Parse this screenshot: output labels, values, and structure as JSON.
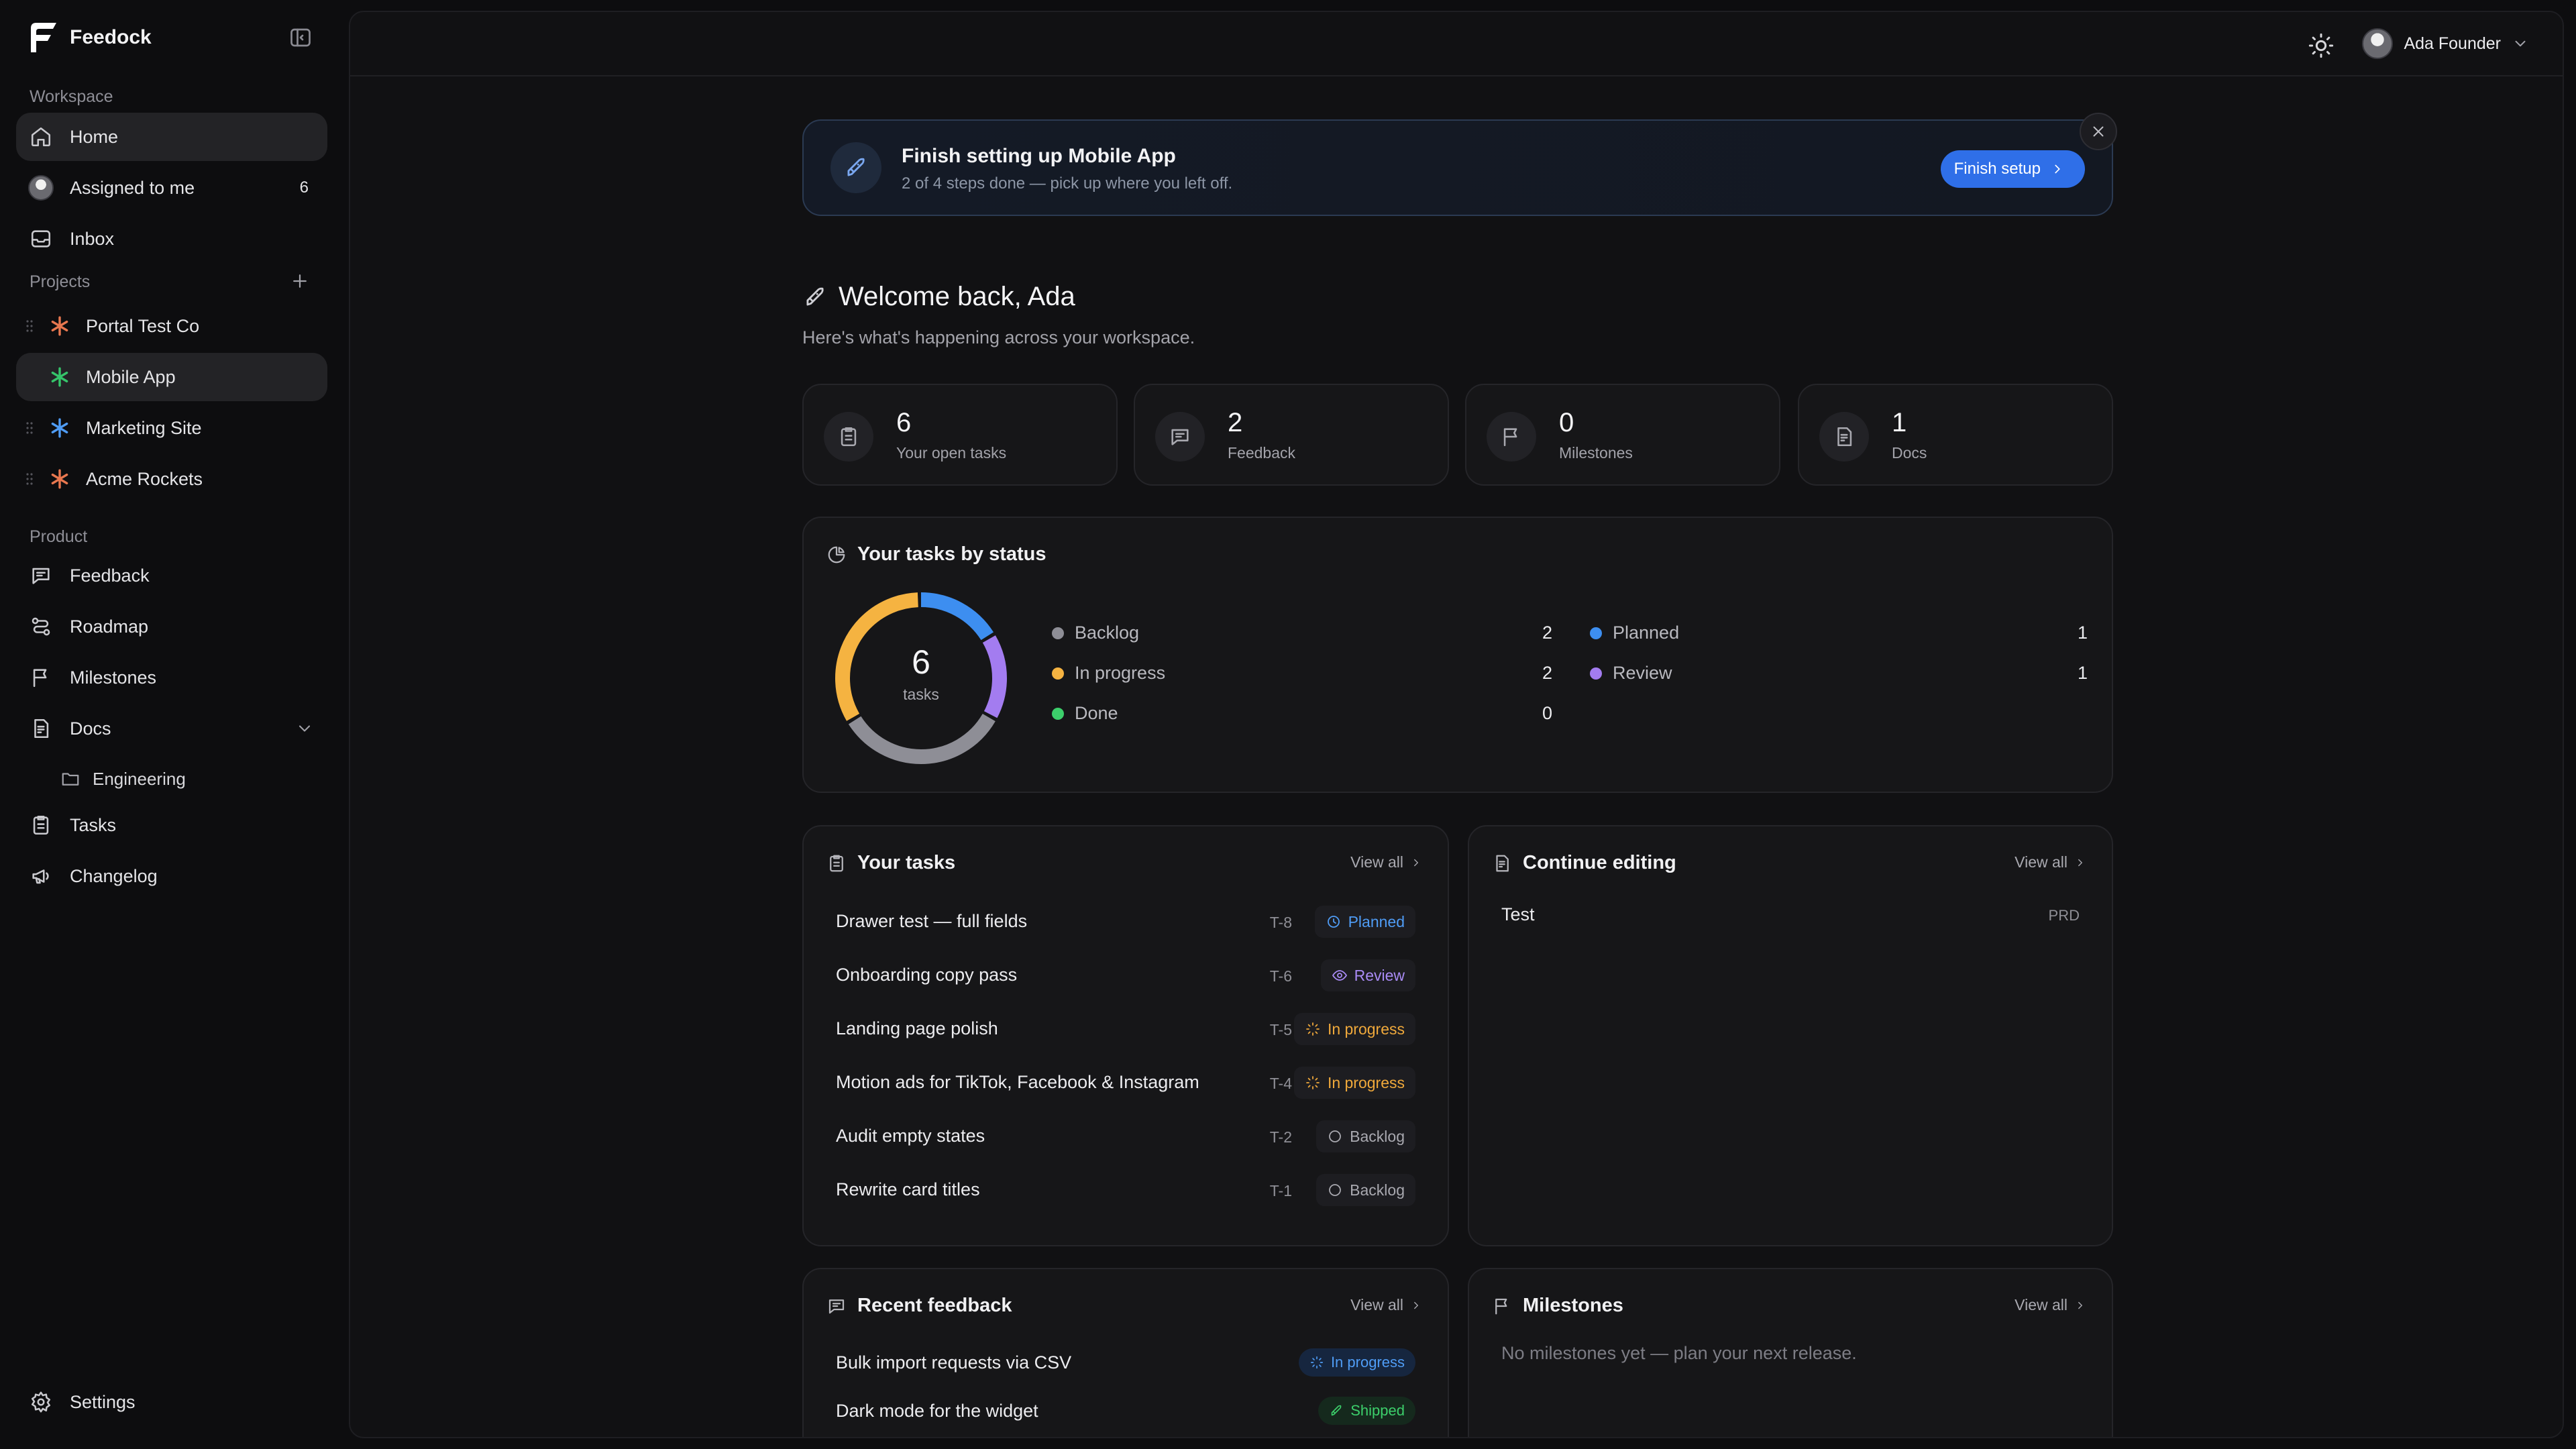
{
  "app": {
    "name": "Feedock"
  },
  "sidebar": {
    "workspace_label": "Workspace",
    "workspace_items": [
      {
        "label": "Home",
        "icon": "home-icon",
        "active": true
      },
      {
        "label": "Assigned to me",
        "icon": "avatar",
        "badge": "6"
      },
      {
        "label": "Inbox",
        "icon": "inbox-icon"
      }
    ],
    "projects_label": "Projects",
    "projects": [
      {
        "label": "Portal Test Co",
        "color": "#e8774f"
      },
      {
        "label": "Mobile App",
        "color": "#35c46a",
        "active": true
      },
      {
        "label": "Marketing Site",
        "color": "#4f9cf5"
      },
      {
        "label": "Acme Rockets",
        "color": "#e8774f"
      }
    ],
    "product_label": "Product",
    "product_items": [
      {
        "label": "Feedback",
        "icon": "message-icon"
      },
      {
        "label": "Roadmap",
        "icon": "roadmap-icon"
      },
      {
        "label": "Milestones",
        "icon": "flag-icon"
      },
      {
        "label": "Docs",
        "icon": "doc-icon"
      },
      {
        "label": "Tasks",
        "icon": "clipboard-icon"
      },
      {
        "label": "Changelog",
        "icon": "megaphone-icon"
      }
    ],
    "docs_sub": {
      "label": "Engineering",
      "icon": "folder-icon"
    },
    "settings_label": "Settings"
  },
  "topbar": {
    "user_name": "Ada Founder"
  },
  "banner": {
    "title": "Finish setting up Mobile App",
    "subtitle": "2 of 4 steps done — pick up where you left off.",
    "button": "Finish setup"
  },
  "welcome": {
    "title": "Welcome back, Ada",
    "subtitle": "Here's what's happening across your workspace."
  },
  "stats": [
    {
      "value": "6",
      "label": "Your open tasks",
      "icon": "clipboard-icon"
    },
    {
      "value": "2",
      "label": "Feedback",
      "icon": "message-icon"
    },
    {
      "value": "0",
      "label": "Milestones",
      "icon": "flag-icon"
    },
    {
      "value": "1",
      "label": "Docs",
      "icon": "doc-icon"
    }
  ],
  "status_card": {
    "title": "Your tasks by status",
    "total": "6",
    "total_label": "tasks",
    "statuses": [
      {
        "label": "Backlog",
        "count": 2,
        "color": "#8e8e96"
      },
      {
        "label": "In progress",
        "count": 2,
        "color": "#f5b341"
      },
      {
        "label": "Done",
        "count": 0,
        "color": "#3ccf6b"
      },
      {
        "label": "Planned",
        "count": 1,
        "color": "#3d8ef0"
      },
      {
        "label": "Review",
        "count": 1,
        "color": "#a37cf0"
      }
    ]
  },
  "tasks_card": {
    "title": "Your tasks",
    "view_all": "View all",
    "tasks": [
      {
        "name": "Drawer test — full fields",
        "id": "T-8",
        "status": "Planned",
        "status_color": "#4f9cf5",
        "icon": "clock-icon"
      },
      {
        "name": "Onboarding copy pass",
        "id": "T-6",
        "status": "Review",
        "status_color": "#a98bf5",
        "icon": "eye-icon"
      },
      {
        "name": "Landing page polish",
        "id": "T-5",
        "status": "In progress",
        "status_color": "#f0a93b",
        "icon": "loader-icon"
      },
      {
        "name": "Motion ads for TikTok, Facebook & Instagram",
        "id": "T-4",
        "status": "In progress",
        "status_color": "#f0a93b",
        "icon": "loader-icon"
      },
      {
        "name": "Audit empty states",
        "id": "T-2",
        "status": "Backlog",
        "status_color": "#a9a9b0",
        "icon": "circle-icon"
      },
      {
        "name": "Rewrite card titles",
        "id": "T-1",
        "status": "Backlog",
        "status_color": "#a9a9b0",
        "icon": "circle-icon"
      }
    ]
  },
  "continue_card": {
    "title": "Continue editing",
    "view_all": "View all",
    "items": [
      {
        "name": "Test",
        "tag": "PRD"
      }
    ]
  },
  "feedback_card": {
    "title": "Recent feedback",
    "view_all": "View all",
    "items": [
      {
        "name": "Bulk import requests via CSV",
        "status": "In progress",
        "color": "#4f9cf5",
        "bg": "#16263f",
        "icon": "loader-icon"
      },
      {
        "name": "Dark mode for the widget",
        "status": "Shipped",
        "color": "#3ccf6b",
        "bg": "#15291d",
        "icon": "rocket-icon"
      }
    ]
  },
  "milestones_card": {
    "title": "Milestones",
    "view_all": "View all",
    "empty": "No milestones yet — plan your next release."
  }
}
